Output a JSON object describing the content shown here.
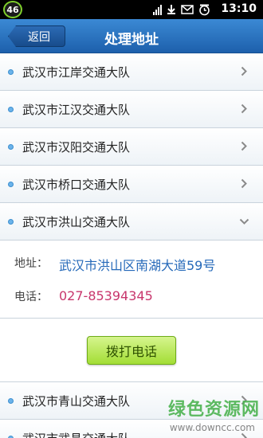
{
  "status_bar": {
    "badge": "46",
    "time": "13:10",
    "icons": [
      "signal-icon",
      "download-icon",
      "message-icon",
      "alarm-icon"
    ]
  },
  "header": {
    "back_label": "返回",
    "title": "处理地址"
  },
  "list": {
    "items": [
      {
        "label": "武汉市江岸交通大队"
      },
      {
        "label": "武汉市江汉交通大队"
      },
      {
        "label": "武汉市汉阳交通大队"
      },
      {
        "label": "武汉市桥口交通大队"
      },
      {
        "label": "武汉市洪山交通大队"
      },
      {
        "label": "武汉市青山交通大队"
      },
      {
        "label": "武汉市武昌交通大队"
      }
    ],
    "expanded": {
      "address_label": "地址：",
      "address_value": "武汉市洪山区南湖大道59号",
      "phone_label": "电话：",
      "phone_value": "027-85394345",
      "dial_label": "拨打电话"
    }
  },
  "watermark": {
    "main": "绿色资源网",
    "sub": "www.downcc.com"
  },
  "colors": {
    "header": "#2a74c3",
    "address": "#2569b9",
    "phone": "#c8366c",
    "dial_button": "#a3dd35"
  }
}
